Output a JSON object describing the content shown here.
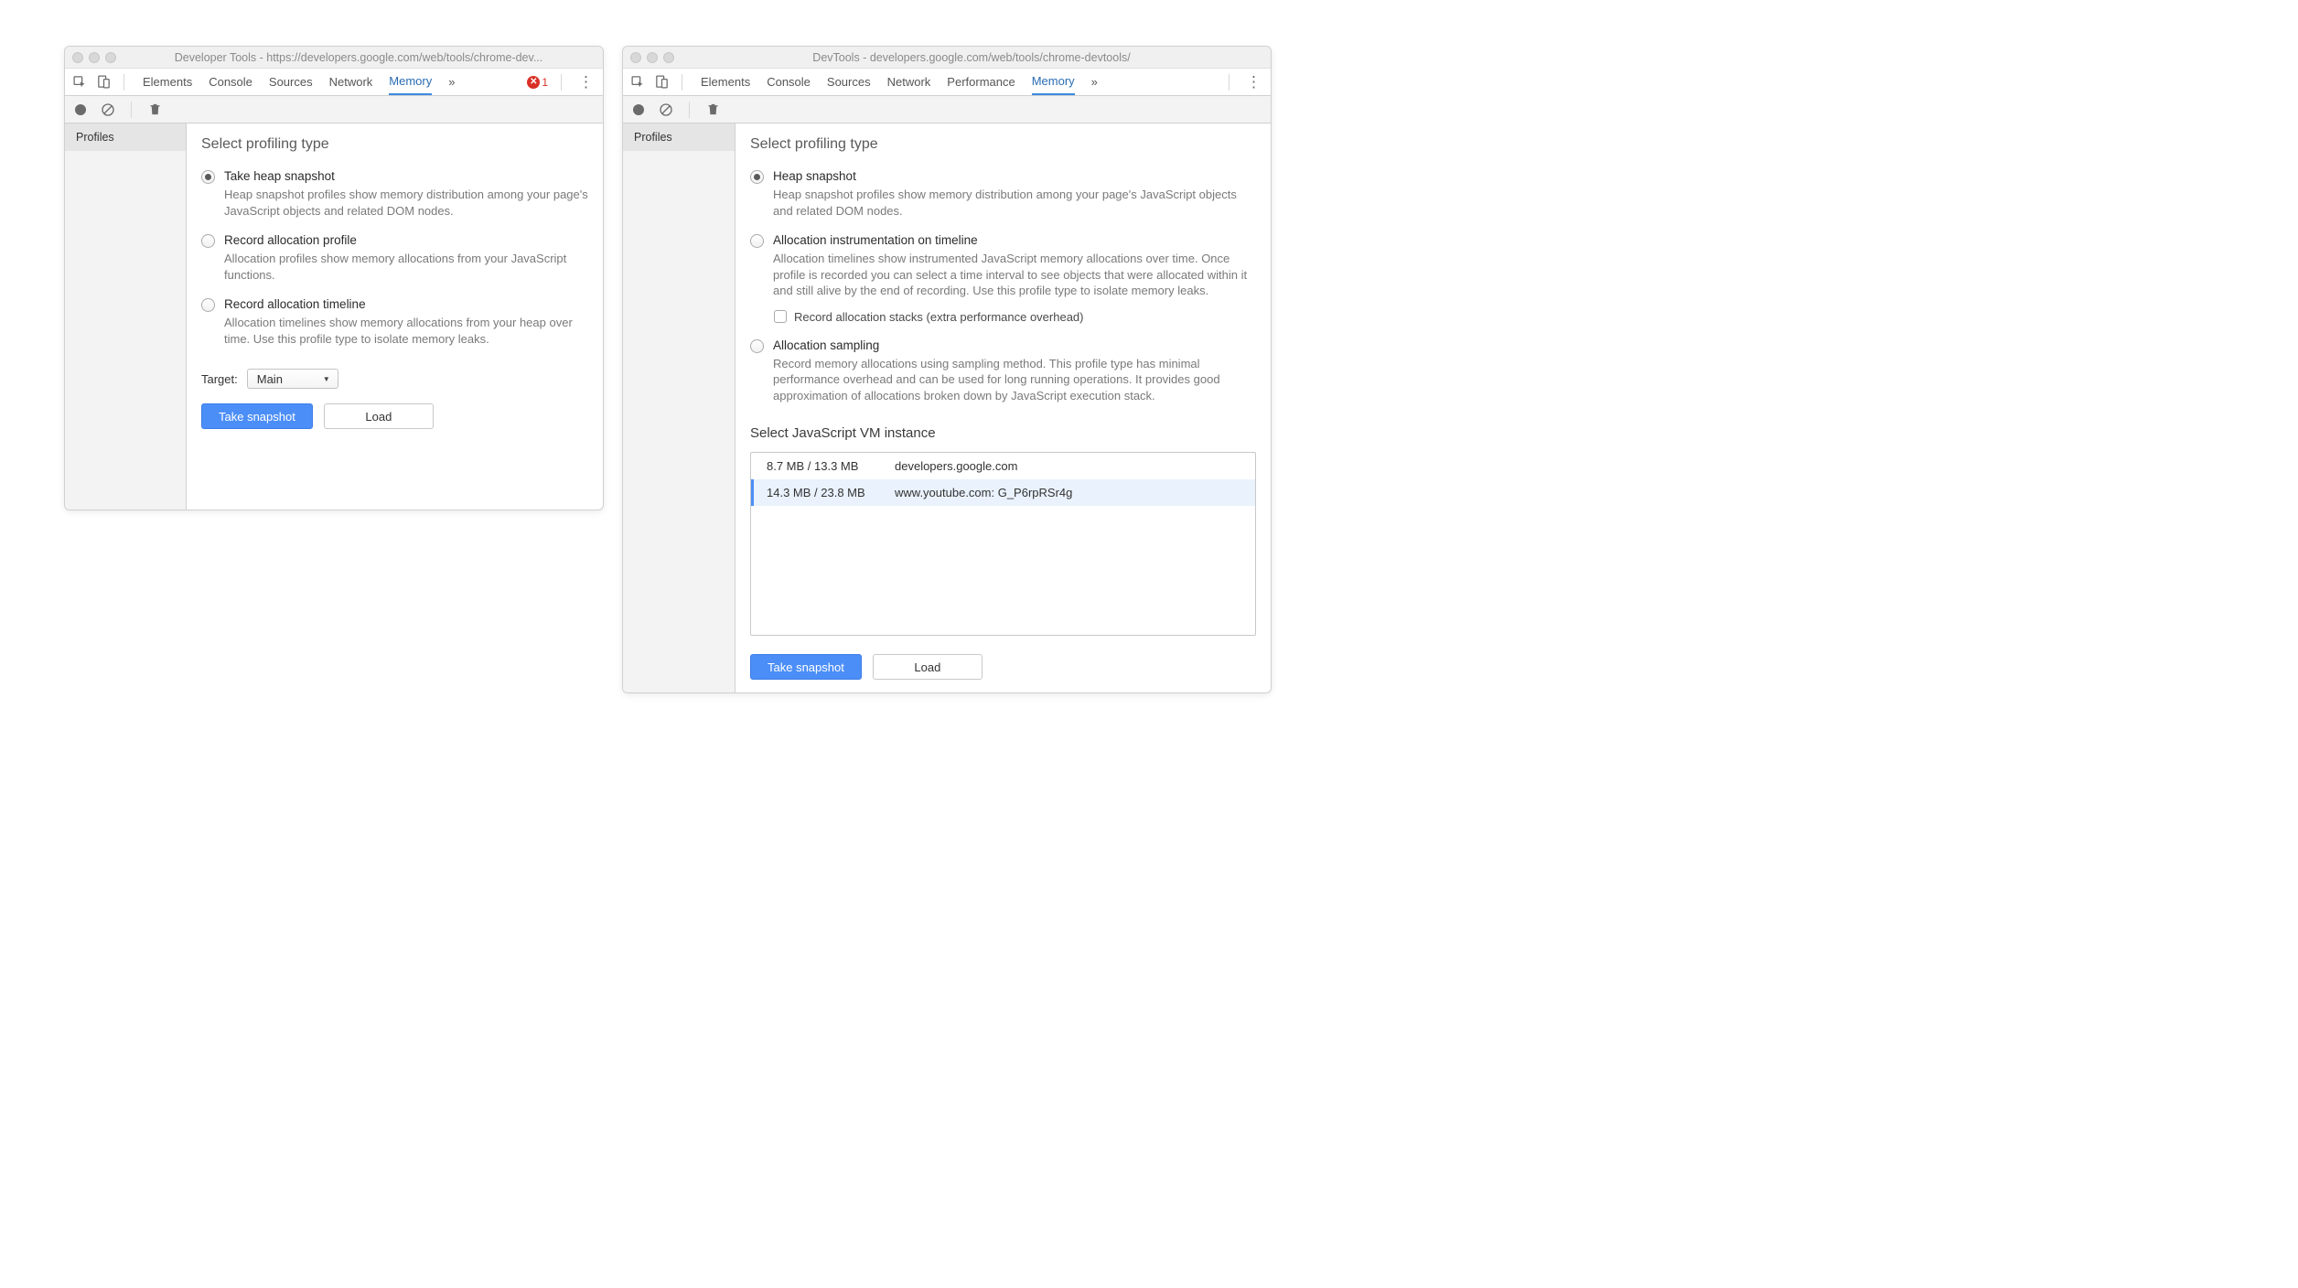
{
  "window1": {
    "title": "Developer Tools - https://developers.google.com/web/tools/chrome-dev...",
    "tabs": [
      "Elements",
      "Console",
      "Sources",
      "Network",
      "Memory"
    ],
    "active_tab": "Memory",
    "error_count": "1",
    "sidebar": {
      "profiles_label": "Profiles"
    },
    "heading": "Select profiling type",
    "options": [
      {
        "title": "Take heap snapshot",
        "desc": "Heap snapshot profiles show memory distribution among your page's JavaScript objects and related DOM nodes.",
        "checked": true
      },
      {
        "title": "Record allocation profile",
        "desc": "Allocation profiles show memory allocations from your JavaScript functions.",
        "checked": false
      },
      {
        "title": "Record allocation timeline",
        "desc": "Allocation timelines show memory allocations from your heap over time. Use this profile type to isolate memory leaks.",
        "checked": false
      }
    ],
    "target_label": "Target:",
    "target_value": "Main",
    "take_snapshot": "Take snapshot",
    "load": "Load"
  },
  "window2": {
    "title": "DevTools - developers.google.com/web/tools/chrome-devtools/",
    "tabs": [
      "Elements",
      "Console",
      "Sources",
      "Network",
      "Performance",
      "Memory"
    ],
    "active_tab": "Memory",
    "sidebar": {
      "profiles_label": "Profiles"
    },
    "heading": "Select profiling type",
    "options": [
      {
        "title": "Heap snapshot",
        "desc": "Heap snapshot profiles show memory distribution among your page's JavaScript objects and related DOM nodes.",
        "checked": true
      },
      {
        "title": "Allocation instrumentation on timeline",
        "desc": "Allocation timelines show instrumented JavaScript memory allocations over time. Once profile is recorded you can select a time interval to see objects that were allocated within it and still alive by the end of recording. Use this profile type to isolate memory leaks.",
        "checked": false,
        "sub_checkbox": "Record allocation stacks (extra performance overhead)"
      },
      {
        "title": "Allocation sampling",
        "desc": "Record memory allocations using sampling method. This profile type has minimal performance overhead and can be used for long running operations. It provides good approximation of allocations broken down by JavaScript execution stack.",
        "checked": false
      }
    ],
    "vm_heading": "Select JavaScript VM instance",
    "vm_instances": [
      {
        "size": "8.7 MB / 13.3 MB",
        "name": "developers.google.com",
        "selected": false
      },
      {
        "size": "14.3 MB / 23.8 MB",
        "name": "www.youtube.com: G_P6rpRSr4g",
        "selected": true
      }
    ],
    "take_snapshot": "Take snapshot",
    "load": "Load"
  }
}
